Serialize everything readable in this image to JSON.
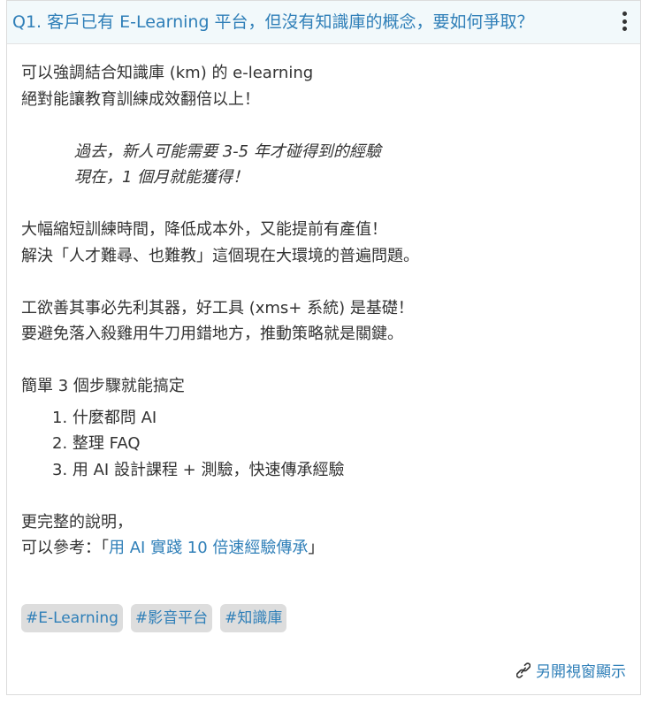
{
  "header": {
    "title": "Q1. 客戶已有 E-Learning 平台，但沒有知識庫的概念，要如何爭取？",
    "more_icon": "kebab-vertical-icon"
  },
  "content": {
    "intro_line1": "可以強調結合知識庫 (km) 的 e-learning",
    "intro_line2": "絕對能讓教育訓練成效翻倍以上！",
    "quote_line1": "過去，新人可能需要 3-5 年才碰得到的經驗",
    "quote_line2": "現在，1 個月就能獲得！",
    "benefit_line1": "大幅縮短訓練時間，降低成本外，又能提前有產值！",
    "benefit_line2": "解決「人才難尋、也難教」這個現在大環境的普遍問題。",
    "tool_line1": "工欲善其事必先利其器，好工具 (xms+ 系統) 是基礎！",
    "tool_line2": "要避免落入殺雞用牛刀用錯地方，推動策略就是關鍵。",
    "steps_heading": "簡單 3 個步驟就能搞定",
    "steps": [
      "1. 什麼都問 AI",
      "2. 整理 FAQ",
      "3. 用 AI 設計課程 + 測驗，快速傳承經驗"
    ],
    "more_line1": "更完整的說明，",
    "more_line2_prefix": "可以參考：「",
    "more_link": "用 AI 實踐 10 倍速經驗傳承",
    "more_line2_suffix": "」"
  },
  "tags": [
    "#E-Learning",
    "#影音平台",
    "#知識庫"
  ],
  "footer": {
    "open_new_window": "另開視窗顯示",
    "link_icon": "link-icon"
  },
  "colors": {
    "accent": "#2f7fb8",
    "header_bg": "#f2f9fb",
    "tag_bg": "#dddddd",
    "text": "#333333"
  }
}
